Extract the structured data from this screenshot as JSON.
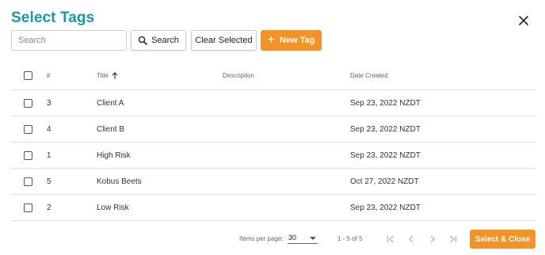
{
  "dialog": {
    "title": "Select Tags",
    "close_icon": "close-icon"
  },
  "toolbar": {
    "search_placeholder": "Search",
    "search_value": "",
    "search_label": "Search",
    "clear_label": "Clear Selected",
    "new_tag_label": "New Tag"
  },
  "table": {
    "headers": {
      "num": "#",
      "title": "Title",
      "description": "Description",
      "date": "Date Created"
    },
    "sort": {
      "column": "title",
      "direction": "ascending"
    },
    "rows": [
      {
        "num": "3",
        "title": "Client A",
        "description": "",
        "date": "Sep 23, 2022 NZDT",
        "selected": false
      },
      {
        "num": "4",
        "title": "Client B",
        "description": "",
        "date": "Sep 23, 2022 NZDT",
        "selected": false
      },
      {
        "num": "1",
        "title": "High Risk",
        "description": "",
        "date": "Sep 23, 2022 NZDT",
        "selected": false
      },
      {
        "num": "5",
        "title": "Kobus Beets",
        "description": "",
        "date": "Oct 27, 2022 NZDT",
        "selected": false
      },
      {
        "num": "2",
        "title": "Low Risk",
        "description": "",
        "date": "Sep 23, 2022 NZDT",
        "selected": false
      }
    ]
  },
  "footer": {
    "items_per_page_label": "Items per page:",
    "items_per_page_value": "30",
    "range_label": "1 - 5 of 5",
    "select_close_label": "Select & Close"
  },
  "colors": {
    "title": "#1a9aa0",
    "accent": "#f39325"
  }
}
